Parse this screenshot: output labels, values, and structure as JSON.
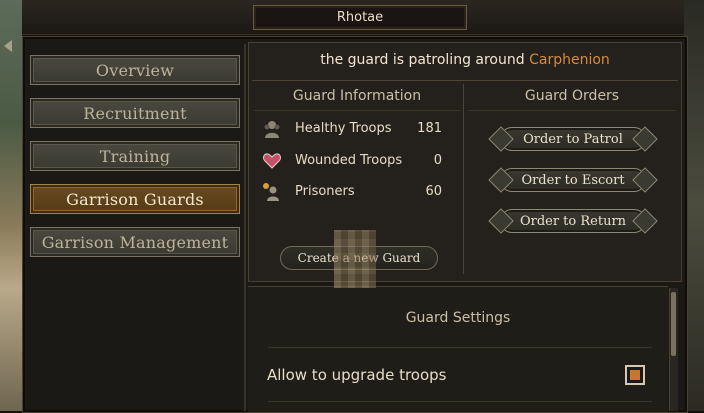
{
  "settlement": {
    "name": "Rhotae"
  },
  "nav": {
    "items": [
      {
        "label": "Overview",
        "active": false
      },
      {
        "label": "Recruitment",
        "active": false
      },
      {
        "label": "Training",
        "active": false
      },
      {
        "label": "Garrison Guards",
        "active": true
      },
      {
        "label": "Garrison Management",
        "active": false
      }
    ]
  },
  "status": {
    "prefix": "the guard is patroling around",
    "place": "Carphenion",
    "place_color": "#d88a3c"
  },
  "guard_info": {
    "title": "Guard Information",
    "rows": [
      {
        "icon": "healthy-troops-icon",
        "label": "Healthy Troops",
        "value": "181"
      },
      {
        "icon": "wounded-troops-icon",
        "label": "Wounded Troops",
        "value": "0"
      },
      {
        "icon": "prisoners-icon",
        "label": "Prisoners",
        "value": "60"
      }
    ],
    "create_label": "Create a new Guard"
  },
  "guard_orders": {
    "title": "Guard Orders",
    "buttons": [
      {
        "label": "Order to Patrol"
      },
      {
        "label": "Order to Escort"
      },
      {
        "label": "Order to Return"
      }
    ]
  },
  "settings": {
    "title": "Guard Settings",
    "options": [
      {
        "label": "Allow to upgrade troops",
        "checked": true
      }
    ]
  },
  "colors": {
    "accent": "#c9752a",
    "active_tab": "#6a4b20"
  }
}
